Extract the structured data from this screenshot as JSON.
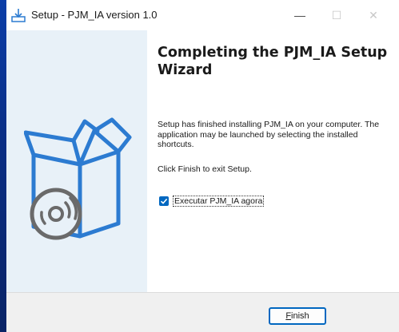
{
  "window": {
    "title": "Setup - PJM_IA version 1.0",
    "controls": {
      "minimize": "—",
      "maximize": "☐",
      "close": "✕"
    }
  },
  "main": {
    "heading": "Completing the PJM_IA Setup Wizard",
    "paragraph1": "Setup has finished installing PJM_IA on your computer. The application may be launched by selecting the installed shortcuts.",
    "paragraph2": "Click Finish to exit Setup.",
    "run_checkbox": {
      "label": "Executar PJM_IA agora",
      "checked": true
    }
  },
  "footer": {
    "finish_label_first": "F",
    "finish_label_rest": "inish"
  },
  "colors": {
    "accent": "#0067c0",
    "side_panel": "#e8f1f8",
    "footer": "#f0f0f0"
  }
}
